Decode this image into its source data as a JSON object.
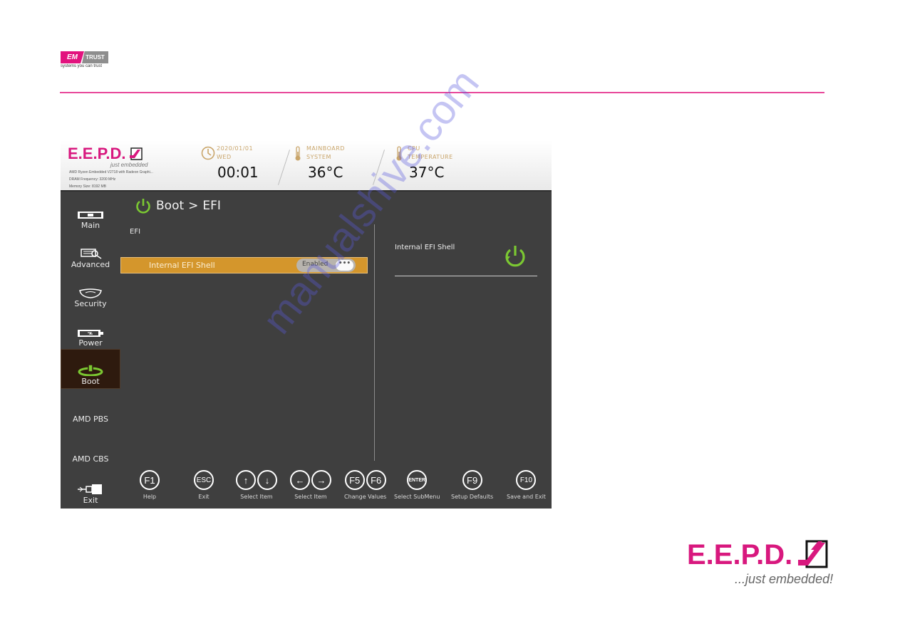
{
  "page": {
    "header_logo": {
      "left": "EM",
      "right": "TRUST",
      "tagline": "systems you can trust"
    },
    "footer_logo": {
      "wordmark": "E.E.P.D.",
      "tagline": "...just embedded!"
    },
    "watermark": "manualshive.com",
    "colors": {
      "brand_pink": "#e2137e",
      "rule_pink": "#e8479a"
    }
  },
  "bios": {
    "brand": {
      "wordmark": "E.E.P.D.",
      "tagline": "just embedded",
      "specs": [
        "AMD Ryzen Embedded V2718 with Radeon Graphi...",
        "DRAM Frequency: 3200 MHz",
        "Memory Size: 8192 MB"
      ]
    },
    "status": {
      "date": "2020/01/01",
      "day": "WED",
      "time": "00:01",
      "mainboard_label1": "MAINBOARD",
      "mainboard_label2": "SYSTEM",
      "mainboard_temp": "36°C",
      "cpu_label1": "CPU",
      "cpu_label2": "TEMPERATURE",
      "cpu_temp": "37°C"
    },
    "sidebar": [
      {
        "label": "Main",
        "icon": "monitor-icon"
      },
      {
        "label": "Advanced",
        "icon": "wrench-icon"
      },
      {
        "label": "Security",
        "icon": "shield-icon"
      },
      {
        "label": "Power",
        "icon": "battery-icon"
      },
      {
        "label": "Boot",
        "icon": "power-icon",
        "active": true
      },
      {
        "label": "AMD PBS"
      },
      {
        "label": "AMD CBS"
      },
      {
        "label": "Exit",
        "icon": "usb-exit-icon"
      }
    ],
    "breadcrumb": {
      "section": "Boot",
      "separator": ">",
      "page": "EFI"
    },
    "section_title": "EFI",
    "settings": [
      {
        "label": "Internal EFI Shell",
        "value": "Enabled",
        "more": "•••",
        "selected": true
      }
    ],
    "help": {
      "title": "Internal EFI Shell"
    },
    "keys": [
      {
        "keys": [
          "F1"
        ],
        "label": "Help"
      },
      {
        "keys": [
          "ESC"
        ],
        "label": "Exit"
      },
      {
        "keys": [
          "↑",
          "↓"
        ],
        "label": "Select Item"
      },
      {
        "keys": [
          "←",
          "→"
        ],
        "label": "Select Item"
      },
      {
        "keys": [
          "F5",
          "F6"
        ],
        "label": "Change Values"
      },
      {
        "keys": [
          "ENTER"
        ],
        "label": "Select  SubMenu"
      },
      {
        "keys": [
          "F9"
        ],
        "label": "Setup Defaults"
      },
      {
        "keys": [
          "F10"
        ],
        "label": "Save and Exit"
      }
    ],
    "colors": {
      "background": "#3f3f3f",
      "selected_row": "#d4962c",
      "accent_green": "#7bc832",
      "label_gold": "#c9a56a",
      "active_tab": "#2e1a0e"
    }
  }
}
